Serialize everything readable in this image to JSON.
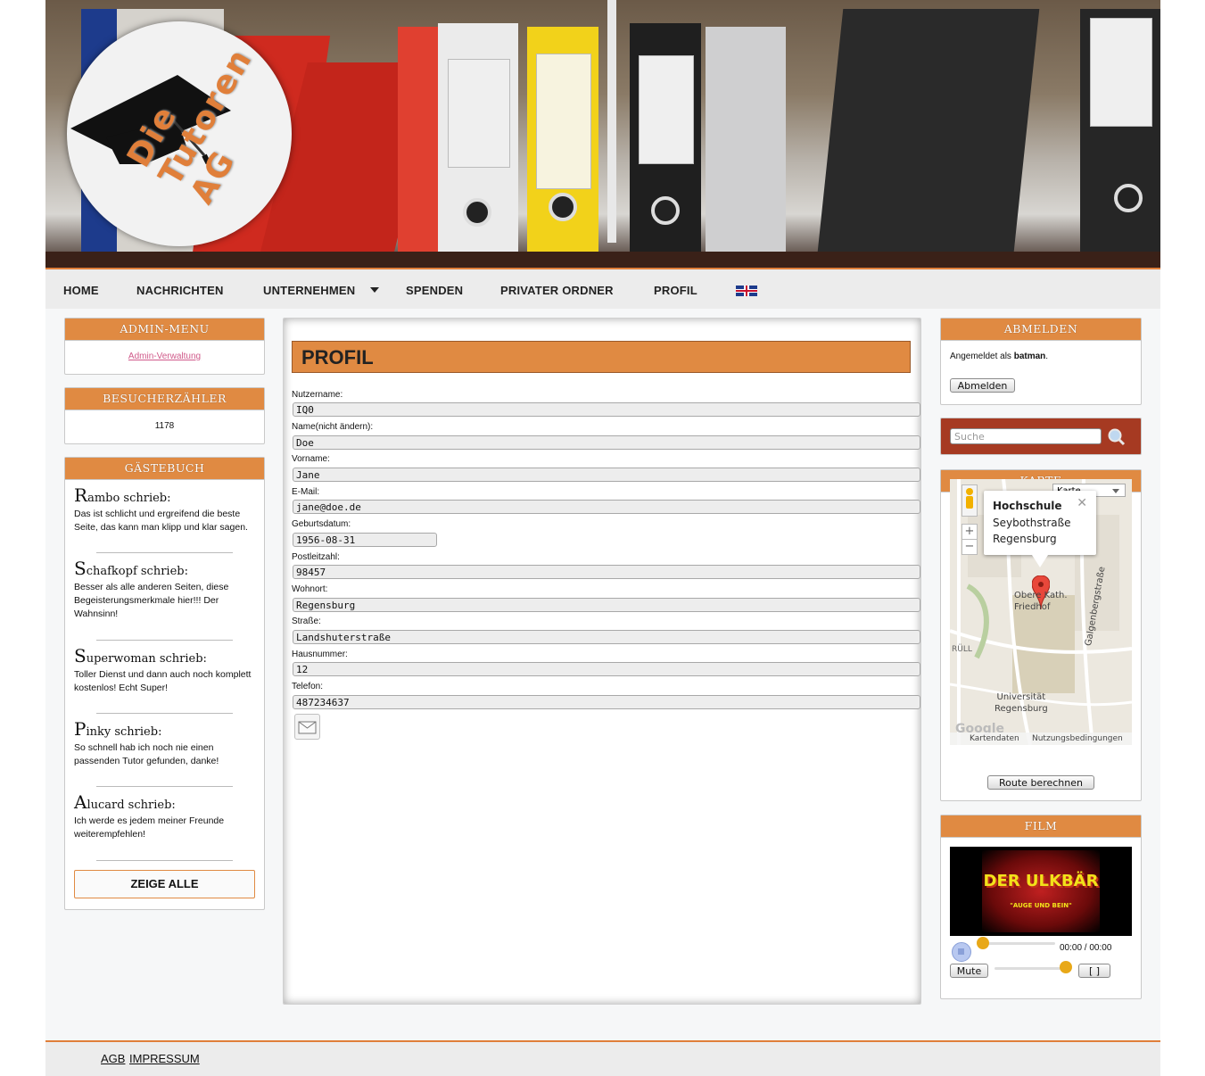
{
  "site": {
    "logo_text": "Die Tutoren AG"
  },
  "nav": {
    "items": [
      "HOME",
      "NACHRICHTEN",
      "UNTERNEHMEN",
      "SPENDEN",
      "PRIVATER ORDNER",
      "PROFIL"
    ],
    "language_flag": "uk-flag-icon"
  },
  "left": {
    "admin": {
      "title": "ADMIN-MENU",
      "link": "Admin-Verwaltung"
    },
    "counter": {
      "title": "BESUCHERZÄHLER",
      "value": "1178"
    },
    "guestbook": {
      "title": "GÄSTEBUCH",
      "entries": [
        {
          "initial": "R",
          "name": "ambo schrieb:",
          "text": "Das ist schlicht und ergreifend die beste Seite, das kann man klipp und klar sagen."
        },
        {
          "initial": "S",
          "name": "chafkopf schrieb:",
          "text": "Besser als alle anderen Seiten, diese Begeisterungsmerkmale hier!!! Der Wahnsinn!"
        },
        {
          "initial": "S",
          "name": "uperwoman schrieb:",
          "text": "Toller Dienst und dann auch noch komplett kostenlos! Echt Super!"
        },
        {
          "initial": "P",
          "name": "inky schrieb:",
          "text": "So schnell hab ich noch nie einen passenden Tutor gefunden, danke!"
        },
        {
          "initial": "A",
          "name": "lucard schrieb:",
          "text": "Ich werde es jedem meiner Freunde weiterempfehlen!"
        }
      ],
      "show_all": "ZEIGE ALLE"
    }
  },
  "main": {
    "title": "PROFIL",
    "fields": [
      {
        "label": "Nutzername:",
        "value": "IQ0"
      },
      {
        "label": "Name(nicht ändern):",
        "value": "Doe"
      },
      {
        "label": "Vorname:",
        "value": "Jane"
      },
      {
        "label": "E-Mail:",
        "value": "jane@doe.de"
      },
      {
        "label": "Geburtsdatum:",
        "value": "1956-08-31"
      },
      {
        "label": "Postleitzahl:",
        "value": "98457"
      },
      {
        "label": "Wohnort:",
        "value": "Regensburg"
      },
      {
        "label": "Straße:",
        "value": "Landshuterstraße"
      },
      {
        "label": "Hausnummer:",
        "value": "12"
      },
      {
        "label": "Telefon:",
        "value": "487234637"
      }
    ]
  },
  "right": {
    "logout": {
      "title": "ABMELDEN",
      "prefix": "Angemeldet als ",
      "user": "batman",
      "suffix": ".",
      "button": "Abmelden"
    },
    "search": {
      "placeholder": "Suche"
    },
    "map": {
      "title": "KARTE",
      "type_select": "Karte",
      "popup_title": "Hochschule",
      "popup_line1": "Seybothstraße",
      "popup_line2": "Regensburg",
      "labels": [
        "Oberer Kath. Friedhof",
        "Galgenbergstraße",
        "Universität Regensburg",
        "RÜLL"
      ],
      "label_friedhof": "Obere Kath.",
      "label_friedhof2": "Friedhof",
      "label_street": "Galgenbergstraße",
      "label_uni": "Universität",
      "label_uni2": "Regensburg",
      "label_ruell": "RÜLL",
      "footer_data": "Kartendaten",
      "footer_terms": "Nutzungsbedingungen",
      "watermark": "Google",
      "zoom_in": "+",
      "zoom_out": "−",
      "route_button": "Route berechnen"
    },
    "film": {
      "title": "FILM",
      "video_title": "DER ULKBÄR",
      "video_subtitle": "\"AUGE UND BEIN\"",
      "time": "00:00 / 00:00",
      "mute": "Mute",
      "fullscreen": "[ ]"
    }
  },
  "footer": {
    "links": [
      "AGB",
      "IMPRESSUM"
    ]
  },
  "colors": {
    "accent": "#e08a42",
    "search_bg": "#a63a22",
    "nav_bg": "#ececec"
  }
}
